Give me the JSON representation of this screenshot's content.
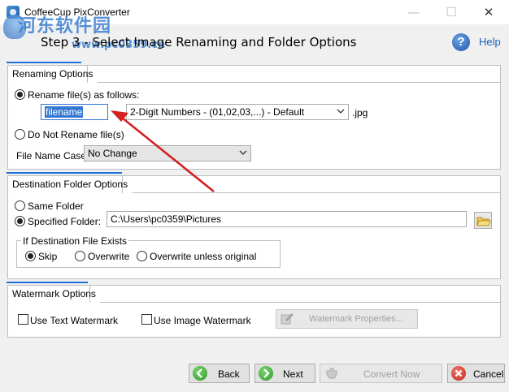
{
  "window": {
    "title": "CoffeeCup PixConverter",
    "minimize_glyph": "—",
    "maximize_glyph": "☐",
    "close_glyph": "✕"
  },
  "watermark": {
    "text": "河东软件园",
    "url": "www.pc0359.cn"
  },
  "header": {
    "step_title": "Step 3 - Select Image Renaming and Folder Options",
    "help_label": "Help",
    "help_glyph": "?"
  },
  "renaming": {
    "title": "Renaming Options",
    "rename_label": "Rename file(s) as follows:",
    "filename_value": "filename",
    "numbering_selected": "2-Digit Numbers - (01,02,03,...) - Default",
    "extension": ".jpg",
    "no_rename_label": "Do Not Rename file(s)",
    "case_label": "File Name Case:",
    "case_selected": "No Change"
  },
  "destination": {
    "title": "Destination Folder Options",
    "same_folder_label": "Same Folder",
    "specified_folder_label": "Specified Folder:",
    "folder_path": "C:\\Users\\pc0359\\Pictures",
    "exists_title": "If Destination File Exists",
    "skip_label": "Skip",
    "overwrite_label": "Overwrite",
    "overwrite_unless_label": "Overwrite unless original"
  },
  "watermark_options": {
    "title": "Watermark Options",
    "text_watermark_label": "Use Text Watermark",
    "image_watermark_label": "Use Image Watermark",
    "properties_label": "Watermark Properties..."
  },
  "footer": {
    "back_label": "Back",
    "next_label": "Next",
    "convert_label": "Convert Now",
    "cancel_label": "Cancel"
  },
  "colors": {
    "accent": "#1f6fd8",
    "annotation_arrow": "#d42020",
    "selection": "#3377d1"
  }
}
